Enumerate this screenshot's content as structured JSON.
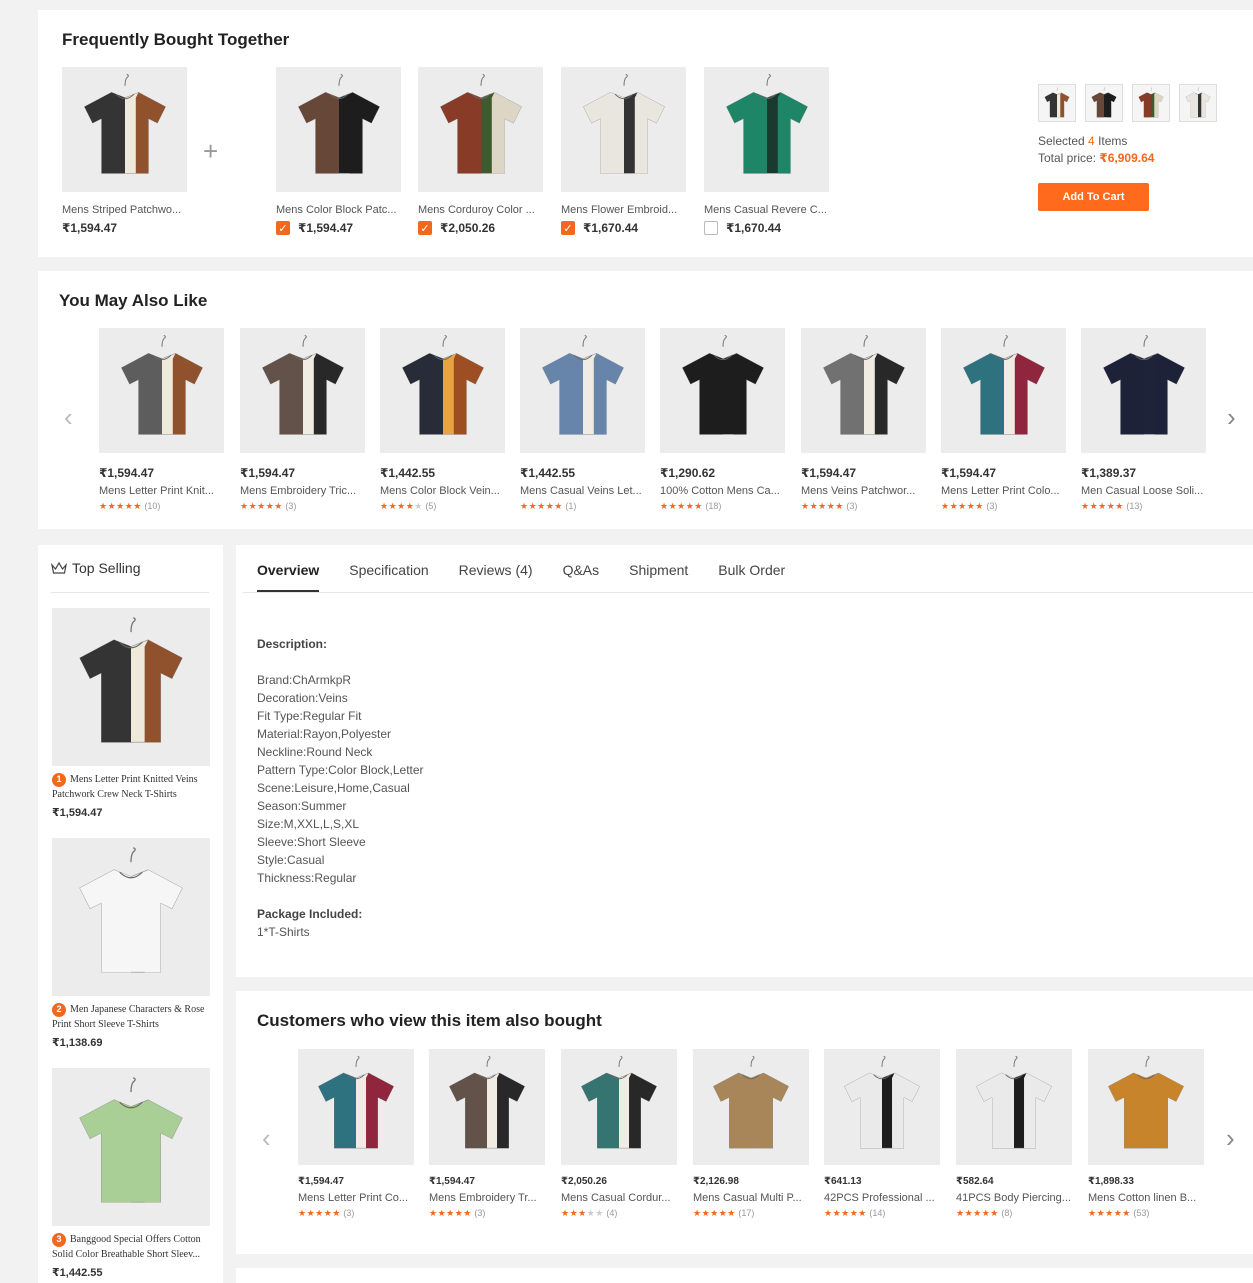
{
  "fbt": {
    "title": "Frequently Bought Together",
    "main": {
      "name": "Mens Striped Patchwo...",
      "price": "₹1,594.47",
      "colors": [
        "#2a2a2a",
        "#efe9dc",
        "#8a4a22"
      ]
    },
    "plus": "+",
    "items": [
      {
        "name": "Mens Color Block Patc...",
        "price": "₹1,594.47",
        "checked": true,
        "check": "✓",
        "colors": [
          "#6b4a3a",
          "#1d1d1d",
          "#1d1d1d"
        ]
      },
      {
        "name": "Mens Corduroy Color ...",
        "price": "₹2,050.26",
        "checked": true,
        "check": "✓",
        "colors": [
          "#8c3b27",
          "#3f5a2e",
          "#e6ddce"
        ]
      },
      {
        "name": "Mens Flower Embroid...",
        "price": "₹1,670.44",
        "checked": true,
        "check": "✓",
        "colors": [
          "#f3f0ea",
          "#333333",
          "#f3f0ea"
        ]
      },
      {
        "name": "Mens Casual Revere C...",
        "price": "₹1,670.44",
        "checked": false,
        "check": "",
        "colors": [
          "#1f8a6a",
          "#1a3a30",
          "#1f8a6a"
        ]
      }
    ],
    "selected_prefix": "Selected ",
    "selected_count": "4",
    "selected_suffix": " Items",
    "total_label": "Total price: ",
    "total_price": "₹6,909.64",
    "add_to_cart": "Add To Cart"
  },
  "ymal": {
    "title": "You May Also Like",
    "prev": "‹",
    "next": "›",
    "items": [
      {
        "price": "₹1,594.47",
        "name": "Mens Letter Print Knit...",
        "stars": 5,
        "count": "(10)",
        "colors": [
          "#555555",
          "#efe9dc",
          "#8a4a22"
        ]
      },
      {
        "price": "₹1,594.47",
        "name": "Mens Embroidery Tric...",
        "stars": 5,
        "count": "(3)",
        "colors": [
          "#5a4a40",
          "#f0ece4",
          "#1d1d1d"
        ]
      },
      {
        "price": "₹1,442.55",
        "name": "Mens Color Block Vein...",
        "stars": 3.5,
        "count": "(5)",
        "colors": [
          "#1d2538",
          "#e9a441",
          "#9a4a22"
        ]
      },
      {
        "price": "₹1,442.55",
        "name": "Mens Casual Veins Let...",
        "stars": 5,
        "count": "(1)",
        "colors": [
          "#5f7fa6",
          "#f0ece4",
          "#5f7fa6"
        ]
      },
      {
        "price": "₹1,290.62",
        "name": "100% Cotton Mens Ca...",
        "stars": 5,
        "count": "(18)",
        "colors": [
          "#1d1d1d",
          "#1d1d1d",
          "#1d1d1d"
        ]
      },
      {
        "price": "₹1,594.47",
        "name": "Mens Veins Patchwor...",
        "stars": 5,
        "count": "(3)",
        "colors": [
          "#6a6a6a",
          "#f0ece4",
          "#1d1d1d"
        ]
      },
      {
        "price": "₹1,594.47",
        "name": "Mens Letter Print Colo...",
        "stars": 5,
        "count": "(3)",
        "colors": [
          "#236b7a",
          "#f0ece4",
          "#8a1a35"
        ]
      },
      {
        "price": "₹1,389.37",
        "name": "Men Casual Loose Soli...",
        "stars": 5,
        "count": "(13)",
        "colors": [
          "#1d2338",
          "#1d2338",
          "#1d2338"
        ]
      }
    ]
  },
  "top_selling": {
    "title": "Top Selling",
    "items": [
      {
        "rank": "1",
        "name": "Mens Letter Print Knitted Veins Patchwork Crew Neck T-Shirts",
        "price": "₹1,594.47",
        "colors": [
          "#2a2a2a",
          "#efe9dc",
          "#8a4a22"
        ]
      },
      {
        "rank": "2",
        "name": "Men Japanese Characters & Rose Print Short Sleeve T-Shirts",
        "price": "₹1,138.69",
        "colors": [
          "#f6f6f6",
          "#f6f6f6",
          "#f6f6f6"
        ]
      },
      {
        "rank": "3",
        "name": "Banggood Special Offers Cotton Solid Color Breathable Short Sleev...",
        "price": "₹1,442.55",
        "colors": [
          "#a9cf96",
          "#a9cf96",
          "#a9cf96"
        ]
      }
    ]
  },
  "tabs": [
    "Overview",
    "Specification",
    "Reviews (4)",
    "Q&As",
    "Shipment",
    "Bulk Order"
  ],
  "description": {
    "heading": "Description:",
    "lines": [
      "Brand:ChArmkpR",
      "Decoration:Veins",
      "Fit Type:Regular Fit",
      "Material:Rayon,Polyester",
      "Neckline:Round Neck",
      "Pattern Type:Color Block,Letter",
      "Scene:Leisure,Home,Casual",
      "Season:Summer",
      "Size:M,XXL,L,S,XL",
      "Sleeve:Short Sleeve",
      "Style:Casual",
      "Thickness:Regular"
    ],
    "package_heading": "Package Included:",
    "package": "1*T-Shirts"
  },
  "cwv": {
    "title": "Customers who view this item also bought",
    "prev": "‹",
    "next": "›",
    "items": [
      {
        "price": "₹1,594.47",
        "name": "Mens Letter Print Co...",
        "stars": 5,
        "count": "(3)",
        "colors": [
          "#236b7a",
          "#f0ece4",
          "#8a1a35"
        ]
      },
      {
        "price": "₹1,594.47",
        "name": "Mens Embroidery Tr...",
        "stars": 5,
        "count": "(3)",
        "colors": [
          "#5a4a40",
          "#f0ece4",
          "#1d1d1d"
        ]
      },
      {
        "price": "₹2,050.26",
        "name": "Mens Casual Cordur...",
        "stars": 3,
        "count": "(4)",
        "colors": [
          "#2a6e6a",
          "#f0ece4",
          "#1d1d1d"
        ]
      },
      {
        "price": "₹2,126.98",
        "name": "Mens Casual Multi P...",
        "stars": 5,
        "count": "(17)",
        "colors": [
          "#a8865a",
          "#a8865a",
          "#a8865a"
        ]
      },
      {
        "price": "₹641.13",
        "name": "42PCS Professional ...",
        "stars": 5,
        "count": "(14)",
        "colors": [
          "#f6f6f6",
          "#1d1d1d",
          "#f6f6f6"
        ]
      },
      {
        "price": "₹582.64",
        "name": "41PCS Body Piercing...",
        "stars": 5,
        "count": "(8)",
        "colors": [
          "#f6f6f6",
          "#1d1d1d",
          "#f6f6f6"
        ]
      },
      {
        "price": "₹1,898.33",
        "name": "Mens Cotton linen B...",
        "stars": 5,
        "count": "(53)",
        "colors": [
          "#c8842a",
          "#c8842a",
          "#c8842a"
        ]
      }
    ]
  },
  "colors": {
    "accent": "#f2681e",
    "button": "#ff6a1c"
  }
}
